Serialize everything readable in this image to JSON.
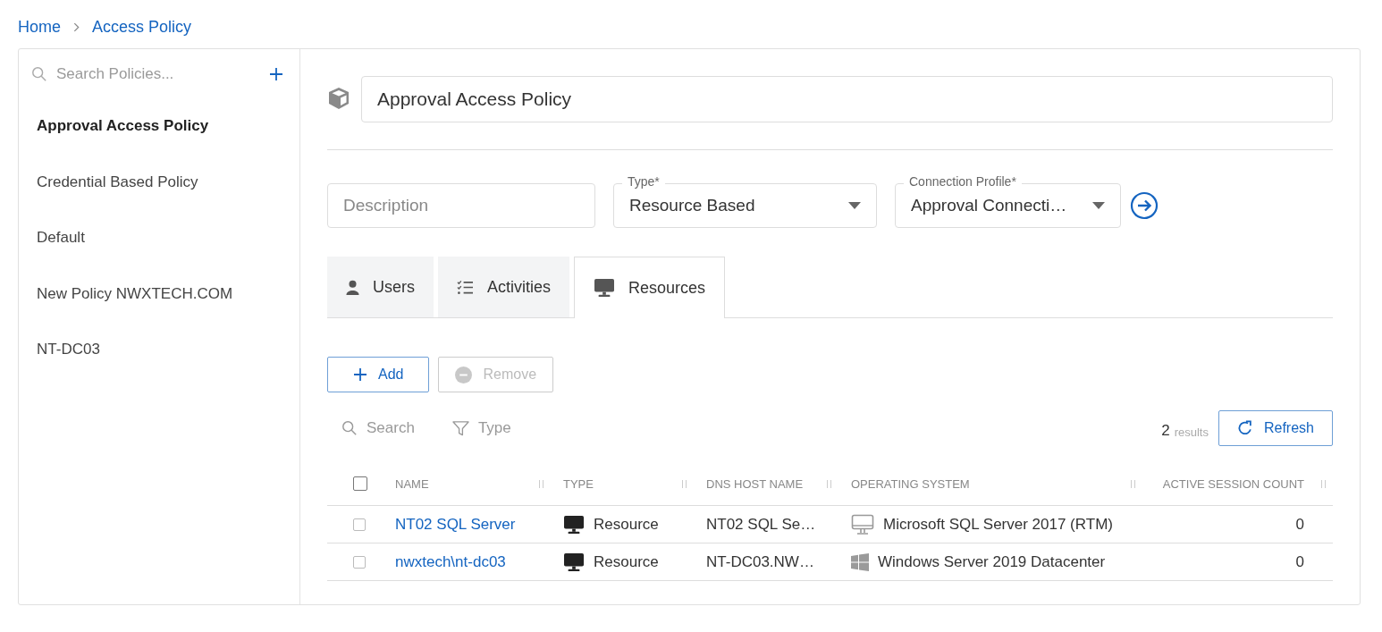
{
  "breadcrumb": [
    {
      "label": "Home"
    },
    {
      "label": "Access Policy"
    }
  ],
  "sidebar": {
    "search": {
      "placeholder": "Search Policies..."
    },
    "items": [
      {
        "label": "Approval Access Policy",
        "selected": true
      },
      {
        "label": "Credential Based Policy",
        "selected": false
      },
      {
        "label": "Default",
        "selected": false
      },
      {
        "label": "New Policy NWXTECH.COM",
        "selected": false
      },
      {
        "label": "NT-DC03",
        "selected": false
      }
    ]
  },
  "policy": {
    "name": "Approval Access Policy"
  },
  "fields": [
    {
      "kind": "text",
      "placeholder": "Description"
    },
    {
      "kind": "select",
      "label": "Type*",
      "value": "Resource Based"
    },
    {
      "kind": "select",
      "label": "Connection Profile*",
      "value": "Approval Connecti…"
    }
  ],
  "tabs": [
    {
      "label": "Users",
      "selected": false
    },
    {
      "label": "Activities",
      "selected": false
    },
    {
      "label": "Resources",
      "selected": true
    }
  ],
  "actions": [
    {
      "label": "Add",
      "disabled": false
    },
    {
      "label": "Remove",
      "disabled": true
    }
  ],
  "filters": [
    {
      "label": "Search"
    },
    {
      "label": "Type"
    }
  ],
  "results": {
    "count": "2",
    "label": "results"
  },
  "refresh": {
    "label": "Refresh"
  },
  "table": {
    "select_all": {
      "checked": false
    },
    "columns": [
      "NAME",
      "TYPE",
      "DNS HOST NAME",
      "OPERATING SYSTEM",
      "ACTIVE SESSION COUNT"
    ],
    "rows": [
      {
        "checked": false,
        "name": "NT02 SQL Server",
        "type": "Resource",
        "dns_host_name": "NT02 SQL Se…",
        "operating_system": "Microsoft SQL Server 2017 (RTM)",
        "active_session_count": "0"
      },
      {
        "checked": false,
        "name": "nwxtech\\nt-dc03",
        "type": "Resource",
        "dns_host_name": "NT-DC03.NW…",
        "operating_system": "Windows Server 2019 Datacenter",
        "active_session_count": "0"
      }
    ]
  }
}
